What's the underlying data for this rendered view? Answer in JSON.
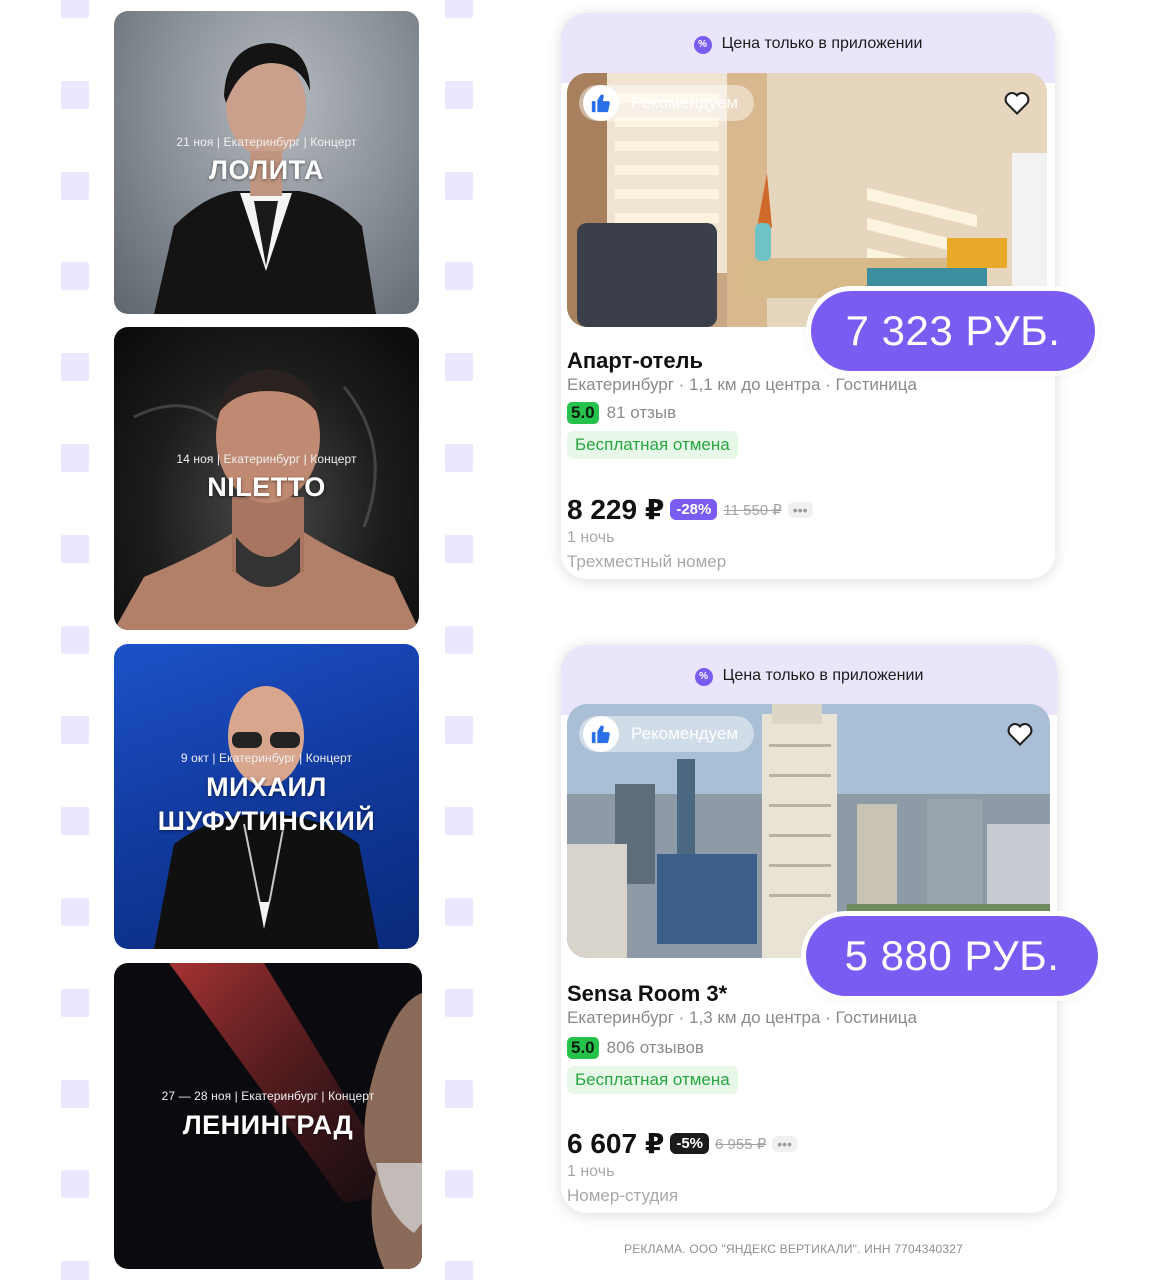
{
  "concerts": [
    {
      "meta": "21 ноя | Екатеринбург | Концерт",
      "title": "ЛОЛИТА"
    },
    {
      "meta": "14 ноя | Екатеринбург | Концерт",
      "title": "NILETTO"
    },
    {
      "meta": "9 окт | Екатеринбург | Концерт",
      "title_line1": "МИХАИЛ",
      "title_line2": "ШУФУТИНСКИЙ"
    },
    {
      "meta": "27 — 28 ноя | Екатеринбург | Концерт",
      "title": "ЛЕНИНГРАД"
    }
  ],
  "hotels": [
    {
      "banner": "Цена только в приложении",
      "recommend": "Рекомендуем",
      "promo_price": "7 323 РУБ.",
      "name": "Апарт-отель",
      "subtitle": "Екатеринбург · 1,1 км до центра · Гостиница",
      "rating": "5.0",
      "reviews": "81 отзыв",
      "free_cancel": "Бесплатная отмена",
      "price": "8 229 ₽",
      "discount": "-28%",
      "old_price": "11 550 ₽",
      "more": "•••",
      "nights": "1 ночь",
      "room": "Трехместный номер"
    },
    {
      "banner": "Цена только в приложении",
      "recommend": "Рекомендуем",
      "promo_price": "5 880 РУБ.",
      "name": "Sensa Room 3*",
      "subtitle": "Екатеринбург · 1,3 км до центра · Гостиница",
      "rating": "5.0",
      "reviews": "806 отзывов",
      "free_cancel": "Бесплатная отмена",
      "price": "6 607 ₽",
      "discount": "-5%",
      "old_price": "6 955 ₽",
      "more": "•••",
      "nights": "1 ночь",
      "room": "Номер-студия"
    }
  ],
  "colors": {
    "accent": "#7b5cf2",
    "banner_bg": "#eae5fb",
    "rating": "#27c24c",
    "free_cancel": "#26a640",
    "discount_1": "#7b5cf2",
    "discount_2": "#1b1b1b"
  },
  "icons": {
    "recommend": "thumbs-up-icon",
    "favorite": "heart-icon",
    "banner": "percent-icon"
  },
  "disclaimer": "РЕКЛАМА. ООО \"ЯНДЕКС ВЕРТИКАЛИ\". ИНН 7704340327"
}
